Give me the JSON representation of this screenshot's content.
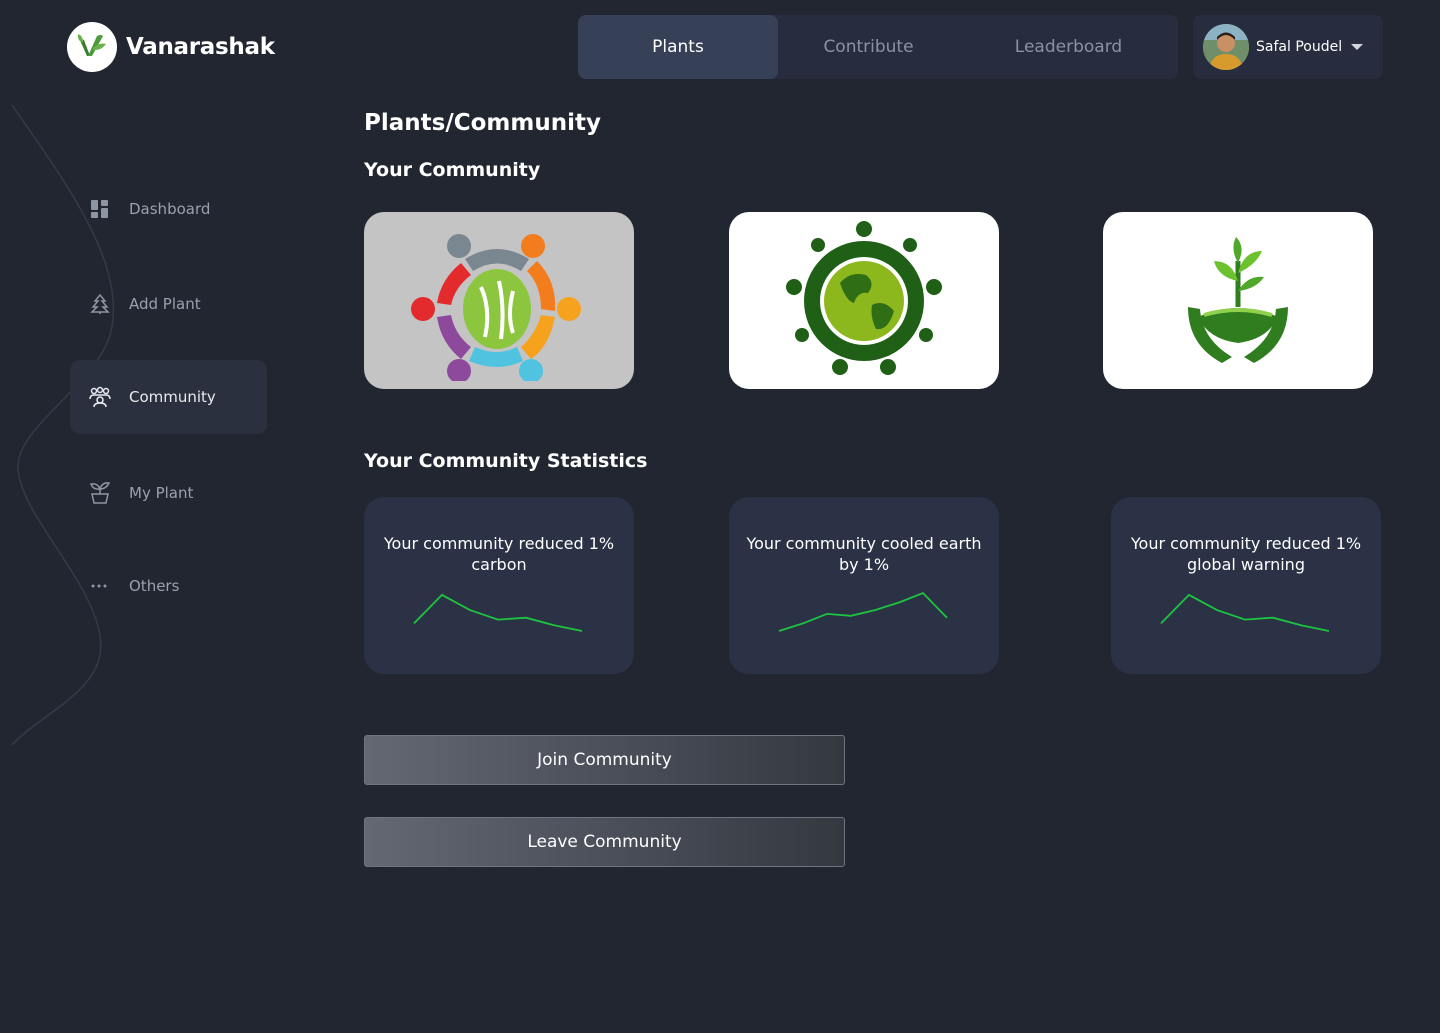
{
  "brand": {
    "name": "Vanarashak"
  },
  "topnav": {
    "tabs": [
      {
        "label": "Plants",
        "active": true
      },
      {
        "label": "Contribute",
        "active": false
      },
      {
        "label": "Leaderboard",
        "active": false
      }
    ]
  },
  "user": {
    "name": "Safal Poudel",
    "menu_icon": "caret-down-icon"
  },
  "sidebar": {
    "items": [
      {
        "label": "Dashboard",
        "icon": "dashboard-grid-icon"
      },
      {
        "label": "Add Plant",
        "icon": "tree-icon"
      },
      {
        "label": "Community",
        "icon": "people-group-icon",
        "active": true
      },
      {
        "label": "My Plant",
        "icon": "potted-plant-icon"
      },
      {
        "label": "Others",
        "icon": "ellipsis-icon"
      }
    ]
  },
  "page": {
    "breadcrumb": "Plants/Community",
    "community_title": "Your Community",
    "stats_title": "Your Community Statistics"
  },
  "communities": [
    {
      "image": "hands-circle-logo"
    },
    {
      "image": "people-around-globe-logo"
    },
    {
      "image": "sprout-in-hands-logo"
    }
  ],
  "stats": [
    {
      "text": "Your community reduced 1% carbon",
      "trend": [
        0.2,
        0.95,
        0.55,
        0.3,
        0.35,
        0.15,
        0.0
      ]
    },
    {
      "text": "Your community cooled earth by 1%",
      "trend": [
        0.0,
        0.2,
        0.45,
        0.4,
        0.55,
        0.75,
        1.0,
        0.35
      ]
    },
    {
      "text": "Your community reduced 1% global warning",
      "trend": [
        0.2,
        0.95,
        0.55,
        0.3,
        0.35,
        0.15,
        0.0
      ]
    }
  ],
  "actions": {
    "join": "Join Community",
    "leave": "Leave Community"
  },
  "colors": {
    "background": "#222630",
    "card": "#2b3246",
    "trend": "#1dc43f",
    "brand_green": "#3f8f3a"
  }
}
